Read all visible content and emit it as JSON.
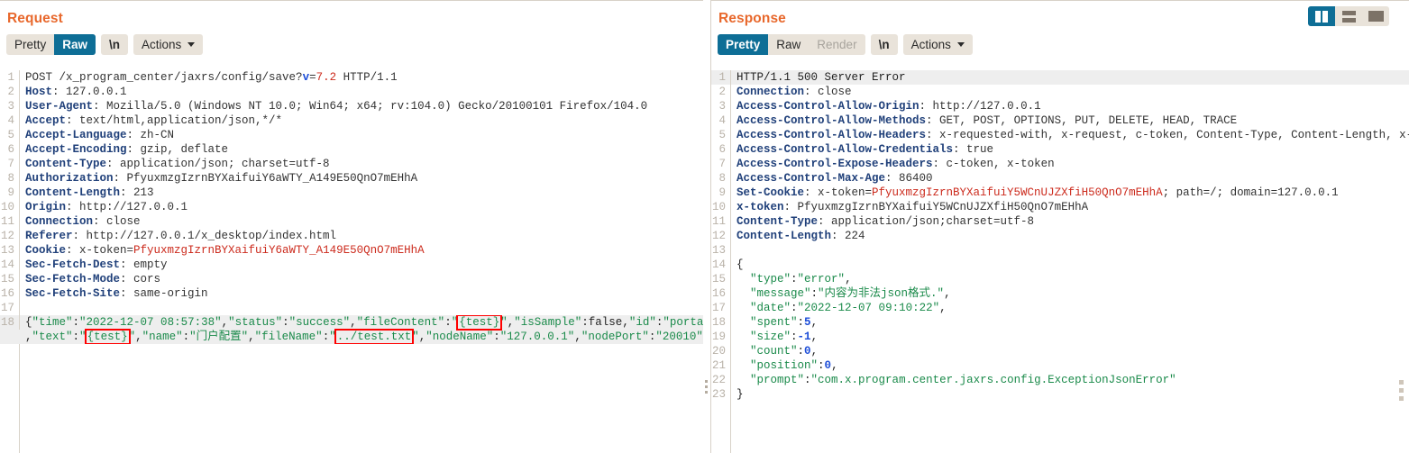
{
  "view_modes": [
    {
      "name": "side-by-side",
      "icon": "columns-icon",
      "active": true
    },
    {
      "name": "stacked",
      "icon": "rows-icon",
      "active": false
    },
    {
      "name": "single",
      "icon": "square-icon",
      "active": false
    }
  ],
  "request": {
    "title": "Request",
    "toolbar": {
      "tabs": [
        {
          "label": "Pretty",
          "active": false,
          "disabled": false
        },
        {
          "label": "Raw",
          "active": true,
          "disabled": false
        }
      ],
      "newline_label": "\\n",
      "actions_label": "Actions"
    },
    "lines": [
      {
        "n": "1",
        "parts": [
          {
            "t": "POST /x_program_center/jaxrs/config/save?",
            "c": "k-txt"
          },
          {
            "t": "v",
            "c": "k-blue"
          },
          {
            "t": "=",
            "c": "k-txt"
          },
          {
            "t": "7.2",
            "c": "k-num"
          },
          {
            "t": " HTTP/1.1",
            "c": "k-txt"
          }
        ]
      },
      {
        "n": "2",
        "parts": [
          {
            "t": "Host",
            "c": "k-hdr"
          },
          {
            "t": ": 127.0.0.1",
            "c": "k-txt"
          }
        ]
      },
      {
        "n": "3",
        "parts": [
          {
            "t": "User-Agent",
            "c": "k-hdr"
          },
          {
            "t": ": Mozilla/5.0 (Windows NT 10.0; Win64; x64; rv:104.0) Gecko/20100101 Firefox/104.0",
            "c": "k-txt"
          }
        ]
      },
      {
        "n": "4",
        "parts": [
          {
            "t": "Accept",
            "c": "k-hdr"
          },
          {
            "t": ": text/html,application/json,*/*",
            "c": "k-txt"
          }
        ]
      },
      {
        "n": "5",
        "parts": [
          {
            "t": "Accept-Language",
            "c": "k-hdr"
          },
          {
            "t": ": zh-CN",
            "c": "k-txt"
          }
        ]
      },
      {
        "n": "6",
        "parts": [
          {
            "t": "Accept-Encoding",
            "c": "k-hdr"
          },
          {
            "t": ": gzip, deflate",
            "c": "k-txt"
          }
        ]
      },
      {
        "n": "7",
        "parts": [
          {
            "t": "Content-Type",
            "c": "k-hdr"
          },
          {
            "t": ": application/json; charset=utf-8",
            "c": "k-txt"
          }
        ]
      },
      {
        "n": "8",
        "parts": [
          {
            "t": "Authorization",
            "c": "k-hdr"
          },
          {
            "t": ": PfyuxmzgIzrnBYXaifuiY6aWTY_A149E50QnO7mEHhA",
            "c": "k-txt"
          }
        ]
      },
      {
        "n": "9",
        "parts": [
          {
            "t": "Content-Length",
            "c": "k-hdr"
          },
          {
            "t": ": 213",
            "c": "k-txt"
          }
        ]
      },
      {
        "n": "10",
        "parts": [
          {
            "t": "Origin",
            "c": "k-hdr"
          },
          {
            "t": ": http://127.0.0.1",
            "c": "k-txt"
          }
        ]
      },
      {
        "n": "11",
        "parts": [
          {
            "t": "Connection",
            "c": "k-hdr"
          },
          {
            "t": ": close",
            "c": "k-txt"
          }
        ]
      },
      {
        "n": "12",
        "parts": [
          {
            "t": "Referer",
            "c": "k-hdr"
          },
          {
            "t": ": http://127.0.0.1/x_desktop/index.html",
            "c": "k-txt"
          }
        ]
      },
      {
        "n": "13",
        "parts": [
          {
            "t": "Cookie",
            "c": "k-hdr"
          },
          {
            "t": ": x-token=",
            "c": "k-txt"
          },
          {
            "t": "PfyuxmzgIzrnBYXaifuiY6aWTY_A149E50QnO7mEHhA",
            "c": "k-red"
          }
        ]
      },
      {
        "n": "14",
        "parts": [
          {
            "t": "Sec-Fetch-Dest",
            "c": "k-hdr"
          },
          {
            "t": ": empty",
            "c": "k-txt"
          }
        ]
      },
      {
        "n": "15",
        "parts": [
          {
            "t": "Sec-Fetch-Mode",
            "c": "k-hdr"
          },
          {
            "t": ": cors",
            "c": "k-txt"
          }
        ]
      },
      {
        "n": "16",
        "parts": [
          {
            "t": "Sec-Fetch-Site",
            "c": "k-hdr"
          },
          {
            "t": ": same-origin",
            "c": "k-txt"
          }
        ]
      },
      {
        "n": "17",
        "parts": [
          {
            "t": "",
            "c": "k-txt"
          }
        ]
      }
    ],
    "body_line_number": "18",
    "body_rows": [
      [
        {
          "t": "{",
          "c": "k-dark"
        },
        {
          "t": "\"time\"",
          "c": "k-str"
        },
        {
          "t": ":",
          "c": "k-dark"
        },
        {
          "t": "\"2022-12-07 08:57:38\"",
          "c": "k-str"
        },
        {
          "t": ",",
          "c": "k-dark"
        },
        {
          "t": "\"status\"",
          "c": "k-str"
        },
        {
          "t": ":",
          "c": "k-dark"
        },
        {
          "t": "\"success\"",
          "c": "k-str"
        },
        {
          "t": ",",
          "c": "k-dark"
        },
        {
          "t": "\"fileContent\"",
          "c": "k-str"
        },
        {
          "t": ":",
          "c": "k-dark"
        },
        {
          "t": "\"",
          "c": "k-str"
        },
        {
          "t": "{test}",
          "c": "k-str",
          "mark": true
        },
        {
          "t": "\"",
          "c": "k-str"
        },
        {
          "t": ",",
          "c": "k-dark"
        },
        {
          "t": "\"isSample\"",
          "c": "k-str"
        },
        {
          "t": ":",
          "c": "k-dark"
        },
        {
          "t": "false",
          "c": "k-dark"
        },
        {
          "t": ",",
          "c": "k-dark"
        },
        {
          "t": "\"id\"",
          "c": "k-str"
        },
        {
          "t": ":",
          "c": "k-dark"
        },
        {
          "t": "\"portal.json\"",
          "c": "k-str"
        }
      ],
      [
        {
          "t": ",",
          "c": "k-dark"
        },
        {
          "t": "\"text\"",
          "c": "k-str"
        },
        {
          "t": ":",
          "c": "k-dark"
        },
        {
          "t": "\"",
          "c": "k-str"
        },
        {
          "t": "{test}",
          "c": "k-str",
          "mark": true
        },
        {
          "t": "\"",
          "c": "k-str"
        },
        {
          "t": ",",
          "c": "k-dark"
        },
        {
          "t": "\"name\"",
          "c": "k-str"
        },
        {
          "t": ":",
          "c": "k-dark"
        },
        {
          "t": "\"门户配置\"",
          "c": "k-str"
        },
        {
          "t": ",",
          "c": "k-dark"
        },
        {
          "t": "\"fileName\"",
          "c": "k-str"
        },
        {
          "t": ":",
          "c": "k-dark"
        },
        {
          "t": "\"",
          "c": "k-str"
        },
        {
          "t": "../test.txt",
          "c": "k-str",
          "mark": true
        },
        {
          "t": "\"",
          "c": "k-str"
        },
        {
          "t": ",",
          "c": "k-dark"
        },
        {
          "t": "\"nodeName\"",
          "c": "k-str"
        },
        {
          "t": ":",
          "c": "k-dark"
        },
        {
          "t": "\"127.0.0.1\"",
          "c": "k-str"
        },
        {
          "t": ",",
          "c": "k-dark"
        },
        {
          "t": "\"nodePort\"",
          "c": "k-str"
        },
        {
          "t": ":",
          "c": "k-dark"
        },
        {
          "t": "\"20010\"",
          "c": "k-str"
        },
        {
          "t": "}",
          "c": "k-dark"
        }
      ]
    ]
  },
  "response": {
    "title": "Response",
    "toolbar": {
      "tabs": [
        {
          "label": "Pretty",
          "active": true,
          "disabled": false
        },
        {
          "label": "Raw",
          "active": false,
          "disabled": false
        },
        {
          "label": "Render",
          "active": false,
          "disabled": true
        }
      ],
      "newline_label": "\\n",
      "actions_label": "Actions"
    },
    "lines": [
      {
        "n": "1",
        "hl": true,
        "parts": [
          {
            "t": "HTTP/1.1 500 Server Error",
            "c": "k-dark"
          }
        ]
      },
      {
        "n": "2",
        "parts": [
          {
            "t": "Connection",
            "c": "k-hdr"
          },
          {
            "t": ": close",
            "c": "k-txt"
          }
        ]
      },
      {
        "n": "3",
        "parts": [
          {
            "t": "Access-Control-Allow-Origin",
            "c": "k-hdr"
          },
          {
            "t": ": http://127.0.0.1",
            "c": "k-txt"
          }
        ]
      },
      {
        "n": "4",
        "parts": [
          {
            "t": "Access-Control-Allow-Methods",
            "c": "k-hdr"
          },
          {
            "t": ": GET, POST, OPTIONS, PUT, DELETE, HEAD, TRACE",
            "c": "k-txt"
          }
        ]
      },
      {
        "n": "5",
        "parts": [
          {
            "t": "Access-Control-Allow-Headers",
            "c": "k-hdr"
          },
          {
            "t": ": x-requested-with, x-request, c-token, Content-Type, Content-Length, x-cipher,",
            "c": "k-txt"
          }
        ]
      },
      {
        "n": "6",
        "parts": [
          {
            "t": "Access-Control-Allow-Credentials",
            "c": "k-hdr"
          },
          {
            "t": ": true",
            "c": "k-txt"
          }
        ]
      },
      {
        "n": "7",
        "parts": [
          {
            "t": "Access-Control-Expose-Headers",
            "c": "k-hdr"
          },
          {
            "t": ": c-token, x-token",
            "c": "k-txt"
          }
        ]
      },
      {
        "n": "8",
        "parts": [
          {
            "t": "Access-Control-Max-Age",
            "c": "k-hdr"
          },
          {
            "t": ": 86400",
            "c": "k-txt"
          }
        ]
      },
      {
        "n": "9",
        "parts": [
          {
            "t": "Set-Cookie",
            "c": "k-hdr"
          },
          {
            "t": ": x-token=",
            "c": "k-txt"
          },
          {
            "t": "PfyuxmzgIzrnBYXaifuiY5WCnUJZXfiH50QnO7mEHhA",
            "c": "k-red"
          },
          {
            "t": "; path=/; domain=127.0.0.1",
            "c": "k-txt"
          }
        ]
      },
      {
        "n": "10",
        "parts": [
          {
            "t": "x-token",
            "c": "k-hdr"
          },
          {
            "t": ": PfyuxmzgIzrnBYXaifuiY5WCnUJZXfiH50QnO7mEHhA",
            "c": "k-txt"
          }
        ]
      },
      {
        "n": "11",
        "parts": [
          {
            "t": "Content-Type",
            "c": "k-hdr"
          },
          {
            "t": ": application/json;charset=utf-8",
            "c": "k-txt"
          }
        ]
      },
      {
        "n": "12",
        "parts": [
          {
            "t": "Content-Length",
            "c": "k-hdr"
          },
          {
            "t": ": 224",
            "c": "k-txt"
          }
        ]
      },
      {
        "n": "13",
        "parts": [
          {
            "t": "",
            "c": "k-txt"
          }
        ]
      },
      {
        "n": "14",
        "parts": [
          {
            "t": "{",
            "c": "k-dark"
          }
        ]
      },
      {
        "n": "15",
        "parts": [
          {
            "t": "  ",
            "c": "k-dark"
          },
          {
            "t": "\"type\"",
            "c": "k-str"
          },
          {
            "t": ":",
            "c": "k-dark"
          },
          {
            "t": "\"error\"",
            "c": "k-str"
          },
          {
            "t": ",",
            "c": "k-dark"
          }
        ]
      },
      {
        "n": "16",
        "parts": [
          {
            "t": "  ",
            "c": "k-dark"
          },
          {
            "t": "\"message\"",
            "c": "k-str"
          },
          {
            "t": ":",
            "c": "k-dark"
          },
          {
            "t": "\"内容为非法json格式.\"",
            "c": "k-str"
          },
          {
            "t": ",",
            "c": "k-dark"
          }
        ]
      },
      {
        "n": "17",
        "parts": [
          {
            "t": "  ",
            "c": "k-dark"
          },
          {
            "t": "\"date\"",
            "c": "k-str"
          },
          {
            "t": ":",
            "c": "k-dark"
          },
          {
            "t": "\"2022-12-07 09:10:22\"",
            "c": "k-str"
          },
          {
            "t": ",",
            "c": "k-dark"
          }
        ]
      },
      {
        "n": "18",
        "parts": [
          {
            "t": "  ",
            "c": "k-dark"
          },
          {
            "t": "\"spent\"",
            "c": "k-str"
          },
          {
            "t": ":",
            "c": "k-dark"
          },
          {
            "t": "5",
            "c": "k-blue"
          },
          {
            "t": ",",
            "c": "k-dark"
          }
        ]
      },
      {
        "n": "19",
        "parts": [
          {
            "t": "  ",
            "c": "k-dark"
          },
          {
            "t": "\"size\"",
            "c": "k-str"
          },
          {
            "t": ":",
            "c": "k-dark"
          },
          {
            "t": "-1",
            "c": "k-blue"
          },
          {
            "t": ",",
            "c": "k-dark"
          }
        ]
      },
      {
        "n": "20",
        "parts": [
          {
            "t": "  ",
            "c": "k-dark"
          },
          {
            "t": "\"count\"",
            "c": "k-str"
          },
          {
            "t": ":",
            "c": "k-dark"
          },
          {
            "t": "0",
            "c": "k-blue"
          },
          {
            "t": ",",
            "c": "k-dark"
          }
        ]
      },
      {
        "n": "21",
        "parts": [
          {
            "t": "  ",
            "c": "k-dark"
          },
          {
            "t": "\"position\"",
            "c": "k-str"
          },
          {
            "t": ":",
            "c": "k-dark"
          },
          {
            "t": "0",
            "c": "k-blue"
          },
          {
            "t": ",",
            "c": "k-dark"
          }
        ]
      },
      {
        "n": "22",
        "parts": [
          {
            "t": "  ",
            "c": "k-dark"
          },
          {
            "t": "\"prompt\"",
            "c": "k-str"
          },
          {
            "t": ":",
            "c": "k-dark"
          },
          {
            "t": "\"com.x.program.center.jaxrs.config.ExceptionJsonError\"",
            "c": "k-str"
          }
        ]
      },
      {
        "n": "23",
        "parts": [
          {
            "t": "}",
            "c": "k-dark"
          }
        ]
      }
    ]
  }
}
